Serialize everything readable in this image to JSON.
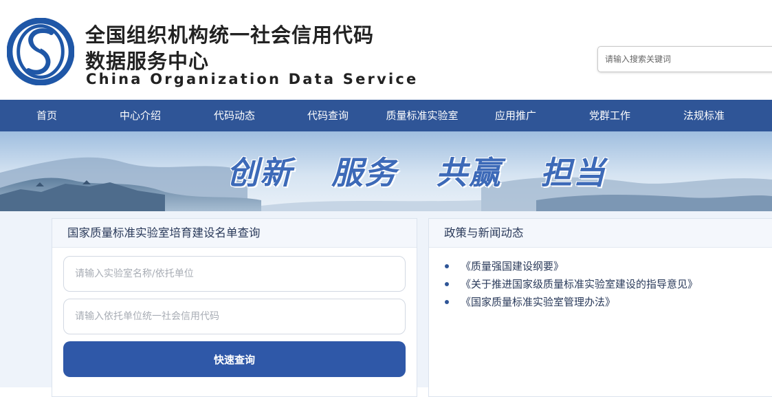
{
  "header": {
    "title_line1": "全国组织机构统一社会信用代码",
    "title_line2": "数据服务中心",
    "title_en": "China Organization Data Service",
    "search_placeholder": "请输入搜索关键词"
  },
  "nav": {
    "items": [
      "首页",
      "中心介绍",
      "代码动态",
      "代码查询",
      "质量标准实验室",
      "应用推广",
      "党群工作",
      "法规标准"
    ]
  },
  "banner": {
    "slogan": [
      "创新",
      "服务",
      "共赢",
      "担当"
    ]
  },
  "lab_query": {
    "title": "国家质量标准实验室培育建设名单查询",
    "name_placeholder": "请输入实验室名称/依托单位",
    "code_placeholder": "请输入依托单位统一社会信用代码",
    "button_label": "快速查询"
  },
  "news": {
    "title": "政策与新闻动态",
    "items": [
      "《质量强国建设纲要》",
      "《关于推进国家级质量标准实验室建设的指导意见》",
      "《国家质量标准实验室管理办法》"
    ]
  },
  "colors": {
    "nav_bg": "#2f5597",
    "button_bg": "#2f58a8",
    "content_bg": "#eef3fa"
  },
  "icons": [
    "logo-mark-icon",
    "bullet-icon"
  ]
}
